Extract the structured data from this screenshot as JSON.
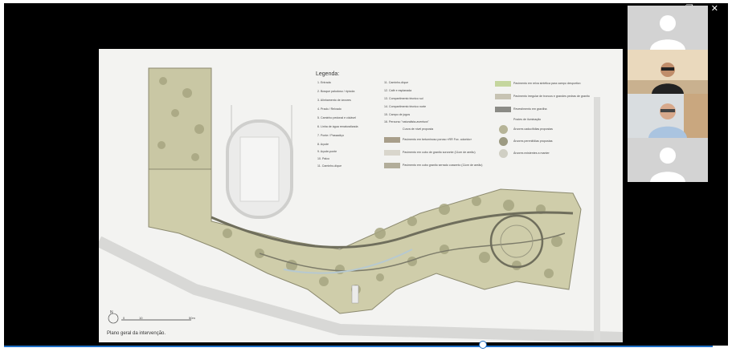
{
  "window_controls": {
    "minimize": "—",
    "maximize": "❐",
    "close": "✕"
  },
  "slide": {
    "legend_title": "Legenda:",
    "caption": "Plano geral da intervenção.",
    "scale": {
      "n": "N",
      "ticks": [
        "0",
        "10",
        "50m"
      ]
    },
    "legend_col1": [
      "1. Entrada",
      "2. Bosque paludoso / ripícola",
      "3. Alinhamento de árvores",
      "4. Prado / Relvado",
      "5. Caminho pedonal e ciclável",
      "6. Linha de água renaturalizada",
      "7. Ponte / Passadiço",
      "8. Açude",
      "9. Açude-ponte",
      "10. Palco",
      "11. Caminho-dique"
    ],
    "legend_col2": [
      "11. Caminho-dique",
      "12. Café e esplanada",
      "13. Compartimento técnico sul",
      "14. Compartimento técnico norte",
      "15. Campo de jogos",
      "16. Percurso \"naturalista-aventura\"",
      "Curva de nível proposta",
      "Pavimento em betuminoso poroso «RR Fox. colorido»",
      "Pavimento em cubo de granito sorvonte (11cm de areão)",
      "Pavimento em cubo granito serrado cossento (11cm de areão)"
    ],
    "legend_col3": [
      "Pavimento em relva sintética para campo desportivo",
      "Pavimento irregular de troncos e grandes pedras de granito",
      "Revestimento em gravilha",
      "Postes de iluminação",
      "Árvores caducifólias propostas",
      "Árvores perenifólias propostas",
      "Árvores existentes a manter"
    ]
  },
  "video": {
    "position": 0.676
  },
  "colors": {
    "accent": "#1f6fc5",
    "slide_bg": "#f3f3f1",
    "field": "#7fb85e"
  }
}
